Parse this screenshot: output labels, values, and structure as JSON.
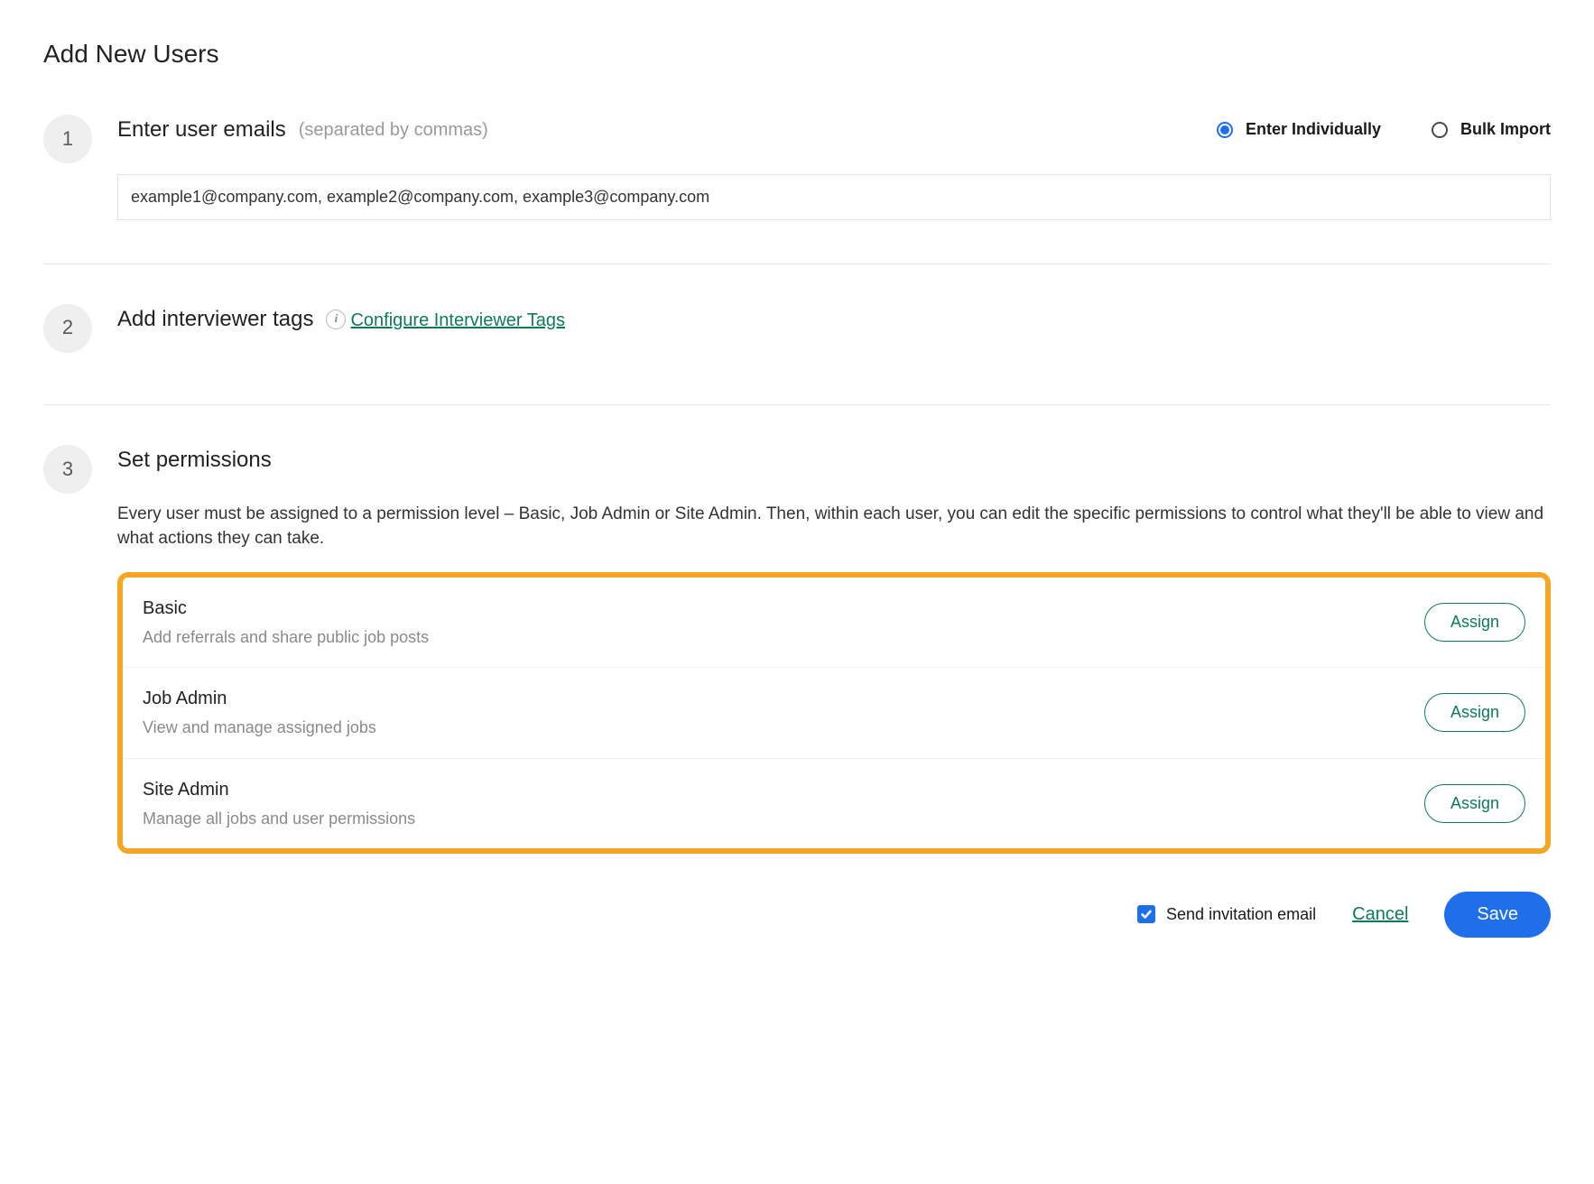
{
  "page": {
    "title": "Add New Users"
  },
  "step1": {
    "number": "1",
    "title": "Enter user emails",
    "hint": "(separated by commas)",
    "emails_value": "example1@company.com, example2@company.com, example3@company.com",
    "mode_options": {
      "individual": {
        "label": "Enter Individually",
        "selected": true
      },
      "bulk": {
        "label": "Bulk Import",
        "selected": false
      }
    }
  },
  "step2": {
    "number": "2",
    "title": "Add interviewer tags",
    "configure_link": "Configure Interviewer Tags"
  },
  "step3": {
    "number": "3",
    "title": "Set permissions",
    "description": "Every user must be assigned to a permission level – Basic, Job Admin or Site Admin. Then, within each user, you can edit the specific permissions to control what they'll be able to view and what actions they can take.",
    "assign_label": "Assign",
    "levels": [
      {
        "name": "Basic",
        "desc": "Add referrals and share public job posts"
      },
      {
        "name": "Job Admin",
        "desc": "View and manage assigned jobs"
      },
      {
        "name": "Site Admin",
        "desc": "Manage all jobs and user permissions"
      }
    ]
  },
  "footer": {
    "send_invite_label": "Send invitation email",
    "send_invite_checked": true,
    "cancel_label": "Cancel",
    "save_label": "Save"
  }
}
